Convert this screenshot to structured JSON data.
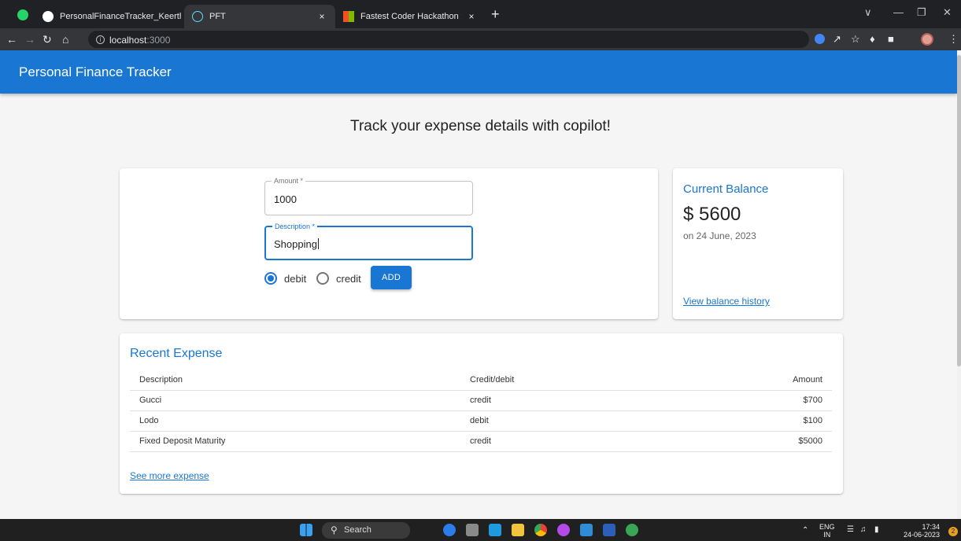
{
  "browser": {
    "tabs": [
      {
        "title": "PersonalFinanceTracker_Keerthan",
        "icon": "github-icon"
      },
      {
        "title": "PFT",
        "icon": "react-icon"
      },
      {
        "title": "Fastest Coder Hackathon for Dev",
        "icon": "microsoft-icon"
      }
    ],
    "close_glyph": "×",
    "new_tab_glyph": "+",
    "url_host": "localhost",
    "url_port": ":3000"
  },
  "app": {
    "title": "Personal Finance Tracker",
    "headline": "Track your expense details with copilot!"
  },
  "form": {
    "amount_label": "Amount *",
    "amount_value": "1000",
    "description_label": "Description *",
    "description_value": "Shopping",
    "radio_debit": "debit",
    "radio_credit": "credit",
    "selected_type": "debit",
    "add_label": "ADD"
  },
  "balance": {
    "title": "Current Balance",
    "amount": "$ 5600",
    "date": "on 24 June, 2023",
    "history_link": "View balance history"
  },
  "expenses": {
    "title": "Recent Expense",
    "columns": [
      "Description",
      "Credit/debit",
      "Amount"
    ],
    "rows": [
      [
        "Gucci",
        "credit",
        "$700"
      ],
      [
        "Lodo",
        "debit",
        "$100"
      ],
      [
        "Fixed Deposit Maturity",
        "credit",
        "$5000"
      ]
    ],
    "see_more": "See more expense"
  },
  "taskbar": {
    "search_label": "Search",
    "lang_top": "ENG",
    "lang_bottom": "IN",
    "time": "17:34",
    "date": "24-06-2023",
    "notification_count": "2"
  },
  "colors": {
    "primary": "#1976d2",
    "background": "#f5f5f5",
    "browser_dark": "#202124"
  }
}
